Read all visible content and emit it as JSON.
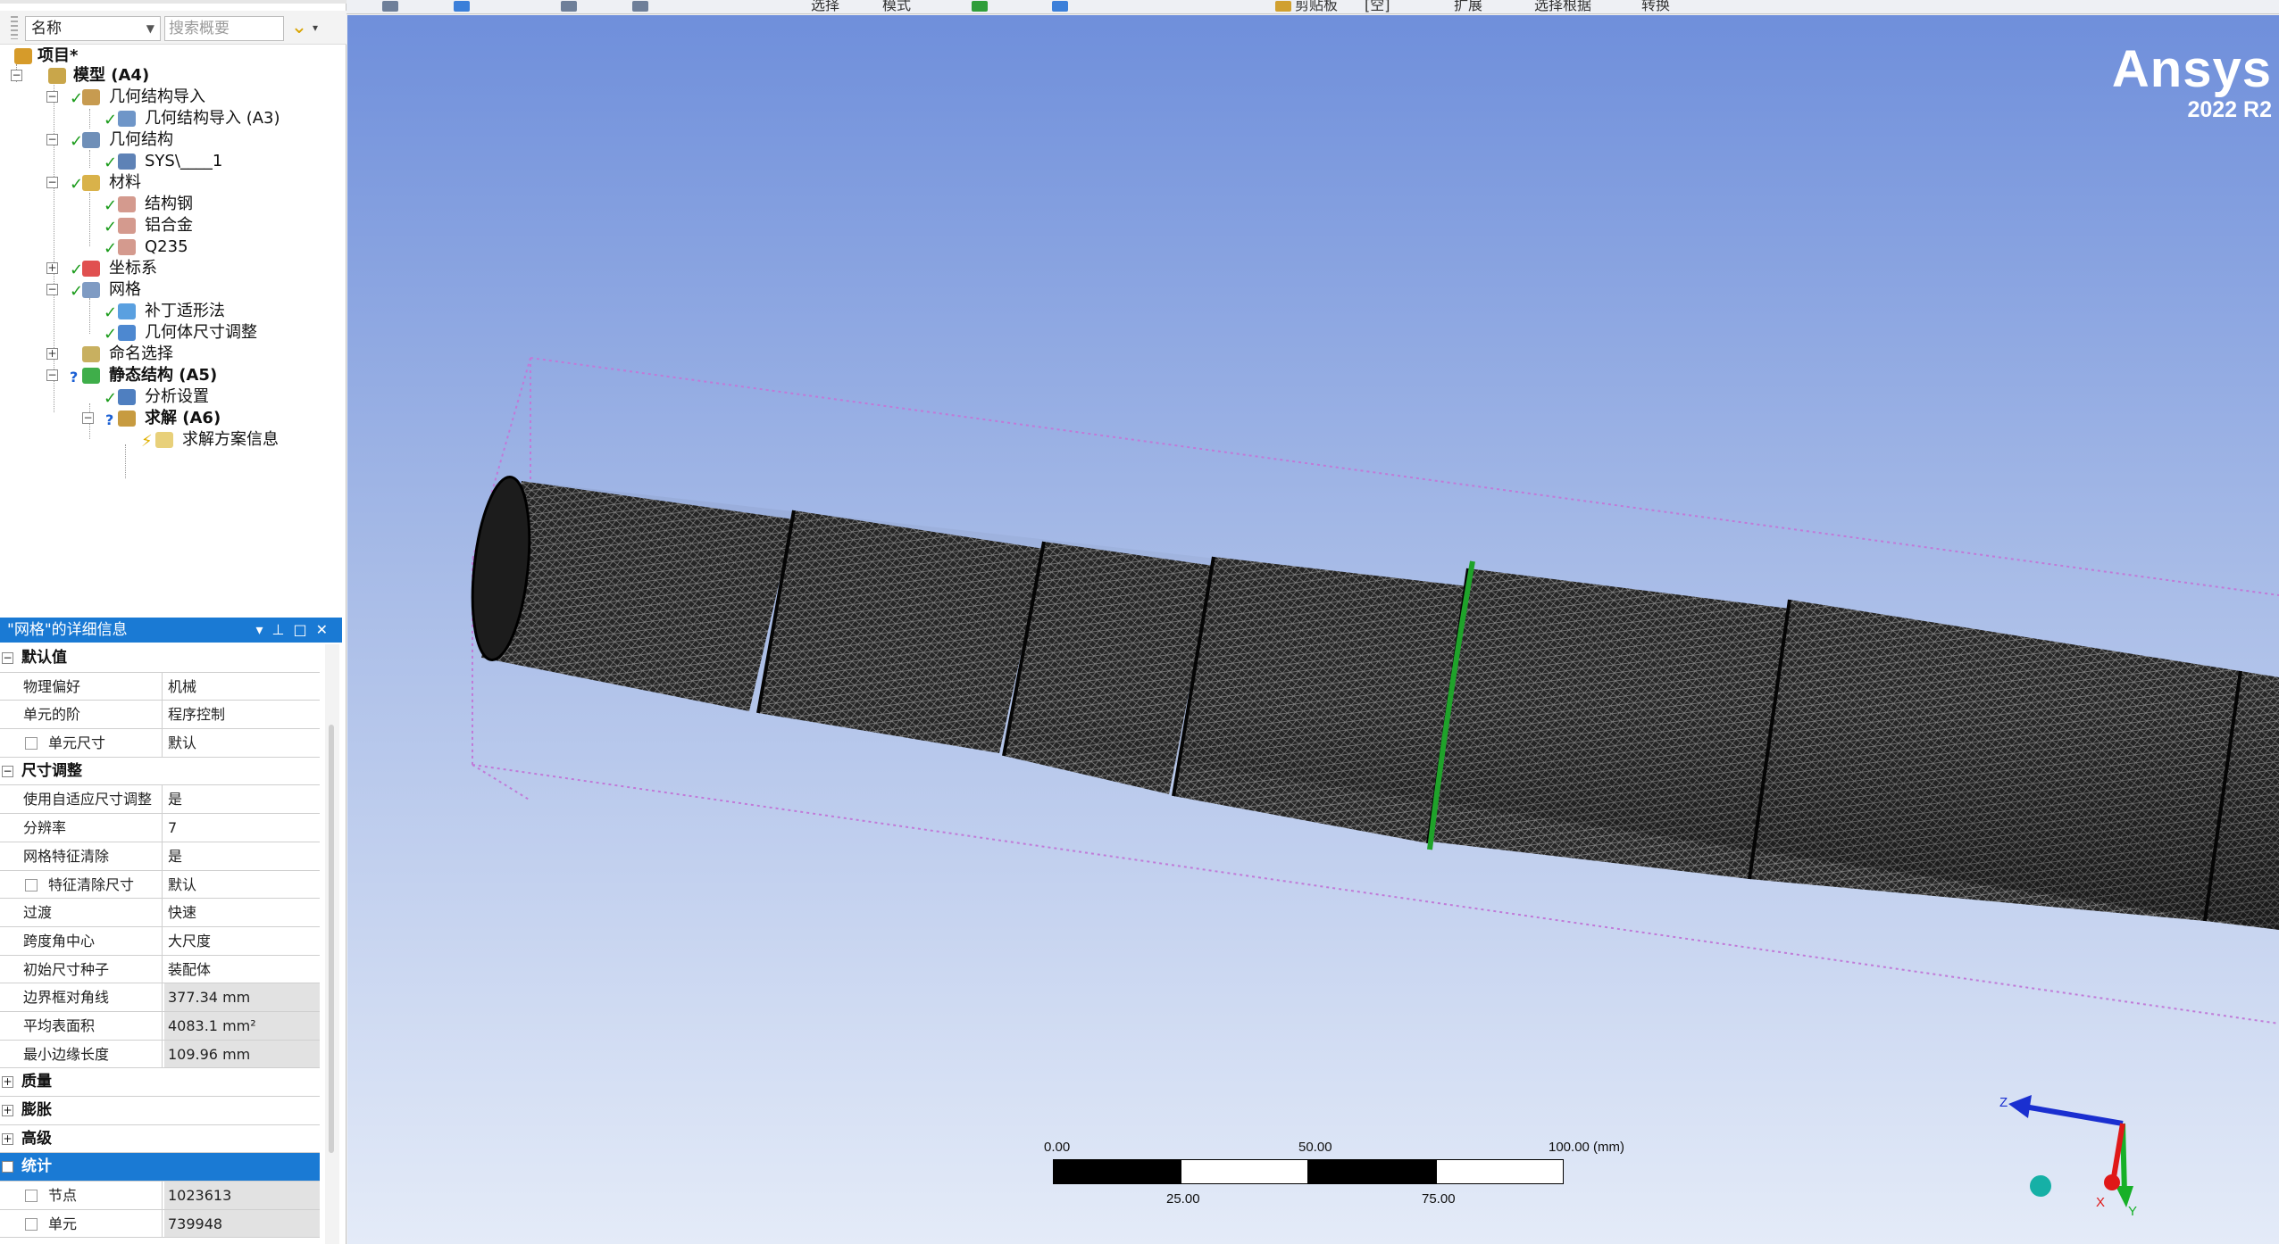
{
  "toolbar": {
    "items": [
      "选择",
      "模式",
      "剪贴板",
      "[空]",
      "扩展",
      "选择根据",
      "转换"
    ]
  },
  "filter": {
    "column_select": "名称",
    "search_placeholder": "搜索概要"
  },
  "tree": {
    "nodes": [
      {
        "label": "项目*"
      },
      {
        "label": "模型 (A4)"
      },
      {
        "label": "几何结构导入"
      },
      {
        "label": "几何结构导入 (A3)"
      },
      {
        "label": "几何结构"
      },
      {
        "label": "SYS\\____1"
      },
      {
        "label": "材料"
      },
      {
        "label": "结构钢"
      },
      {
        "label": "铝合金"
      },
      {
        "label": "Q235"
      },
      {
        "label": "坐标系"
      },
      {
        "label": "网格"
      },
      {
        "label": "补丁适形法"
      },
      {
        "label": "几何体尺寸调整"
      },
      {
        "label": "命名选择"
      },
      {
        "label": "静态结构 (A5)"
      },
      {
        "label": "分析设置"
      },
      {
        "label": "求解 (A6)"
      },
      {
        "label": "求解方案信息"
      }
    ]
  },
  "details": {
    "title": "\"网格\"的详细信息",
    "groups": [
      {
        "label": "默认值",
        "expander": "−",
        "rows": [
          {
            "key": "物理偏好",
            "value": "机械"
          },
          {
            "key": "单元的阶",
            "value": "程序控制"
          },
          {
            "key": "单元尺寸",
            "value": "默认"
          }
        ]
      },
      {
        "label": "尺寸调整",
        "expander": "−",
        "rows": [
          {
            "key": "使用自适应尺寸调整",
            "value": "是"
          },
          {
            "key": "分辨率",
            "value": "7"
          },
          {
            "key": "网格特征清除",
            "value": "是"
          },
          {
            "key": "特征清除尺寸",
            "value": "默认"
          },
          {
            "key": "过渡",
            "value": "快速"
          },
          {
            "key": "跨度角中心",
            "value": "大尺度"
          },
          {
            "key": "初始尺寸种子",
            "value": "装配体"
          },
          {
            "key": "边界框对角线",
            "value": "377.34 mm"
          },
          {
            "key": "平均表面积",
            "value": "4083.1 mm²"
          },
          {
            "key": "最小边缘长度",
            "value": "109.96 mm"
          }
        ]
      },
      {
        "label": "质量",
        "expander": "+"
      },
      {
        "label": "膨胀",
        "expander": "+"
      },
      {
        "label": "高级",
        "expander": "+"
      },
      {
        "label": "统计",
        "expander": "−",
        "rows": [
          {
            "key": "节点",
            "value": "1023613"
          },
          {
            "key": "单元",
            "value": "739948"
          }
        ]
      }
    ]
  },
  "viewport": {
    "logo_name": "Ansys",
    "logo_release": "2022 R2",
    "scale": {
      "top_labels": [
        "0.00",
        "50.00",
        "100.00 (mm)"
      ],
      "bottom_labels": [
        "25.00",
        "75.00"
      ]
    },
    "triad": {
      "z": "Z",
      "x": "X",
      "y": "Y"
    },
    "colors": {
      "mesh": "#1e1e1e",
      "selected_edge": "#1fa32a",
      "bbox": "#c07ad8",
      "triad_z": "#1a2fd0",
      "triad_y": "#17b028",
      "triad_x": "#e01818"
    }
  }
}
